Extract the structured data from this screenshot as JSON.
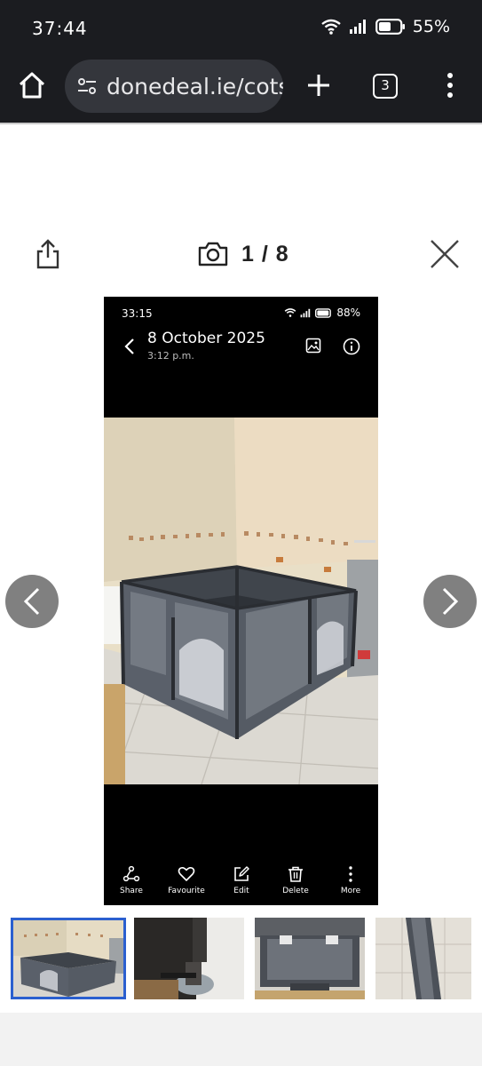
{
  "status_bar": {
    "time": "37:44",
    "battery": "55%",
    "icons": [
      "wifi-icon",
      "signal-icon",
      "battery-icon"
    ]
  },
  "browser": {
    "url": "donedeal.ie/cots",
    "tab_count": "3",
    "icons": [
      "home-icon",
      "tune-icon",
      "plus-icon",
      "tabs-icon",
      "more-vertical-icon"
    ]
  },
  "gallery": {
    "counter": "1 / 8",
    "icons": [
      "share-icon",
      "camera-icon",
      "close-icon",
      "chevron-left-icon",
      "chevron-right-icon"
    ]
  },
  "photo": {
    "status_time": "33:15",
    "status_battery": "88%",
    "date": "8 October 2025",
    "time": "3:12 p.m.",
    "actions": [
      {
        "label": "Share",
        "icon": "share-nodes-icon"
      },
      {
        "label": "Favourite",
        "icon": "heart-icon"
      },
      {
        "label": "Edit",
        "icon": "edit-icon"
      },
      {
        "label": "Delete",
        "icon": "trash-icon"
      },
      {
        "label": "More",
        "icon": "more-vertical-icon"
      }
    ]
  },
  "thumbnails": {
    "count_visible": 4,
    "selected_index": 0,
    "selected_border_color": "#2b5fcf"
  },
  "colors": {
    "browser_bar": "#1b1c20",
    "url_pill": "#34363c",
    "nav_arrow": "#6e6e6e",
    "playpen": "#4b5058"
  }
}
